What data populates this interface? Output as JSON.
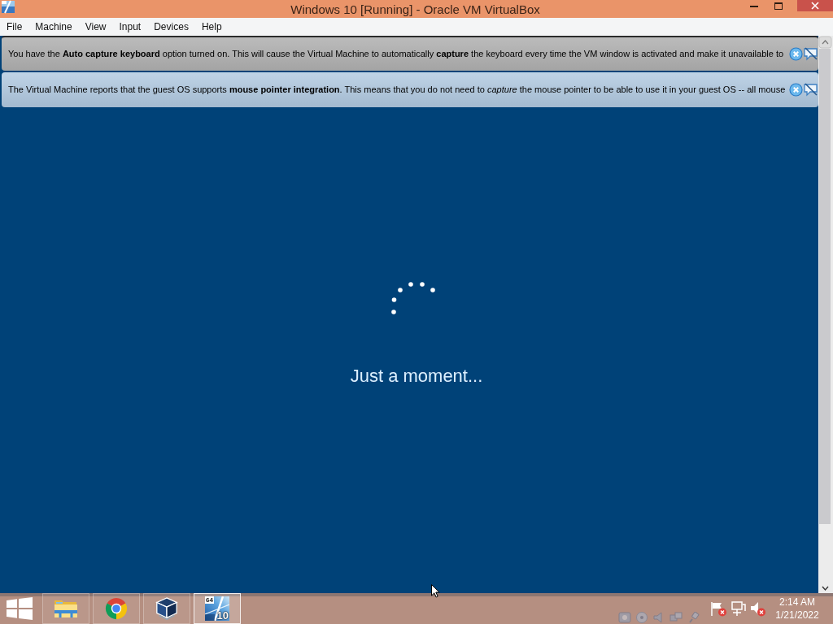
{
  "window": {
    "title": "Windows 10 [Running] - Oracle VM VirtualBox"
  },
  "menu": [
    "File",
    "Machine",
    "View",
    "Input",
    "Devices",
    "Help"
  ],
  "notifications": [
    {
      "kind": "keyboard",
      "text": "You have the **Auto capture keyboard** option turned on. This will cause the Virtual Machine to automatically **capture** the keyboard every time the VM window is activated and make it unavailable to"
    },
    {
      "kind": "mouse",
      "text": "The Virtual Machine reports that the guest OS supports **mouse pointer integration**. This means that you do not need to *capture* the mouse pointer to be able to use it in your guest OS -- all mouse"
    }
  ],
  "guest_screen": {
    "message": "Just a moment..."
  },
  "taskbar": {
    "apps": [
      {
        "kind": "explorer",
        "selected": false
      },
      {
        "kind": "browser",
        "selected": false
      },
      {
        "kind": "virtualbox",
        "selected": false
      },
      {
        "kind": "vm",
        "selected": true,
        "badge": "64",
        "label": "10"
      }
    ],
    "clock": {
      "time": "2:14 AM",
      "date": "1/21/2022"
    }
  }
}
